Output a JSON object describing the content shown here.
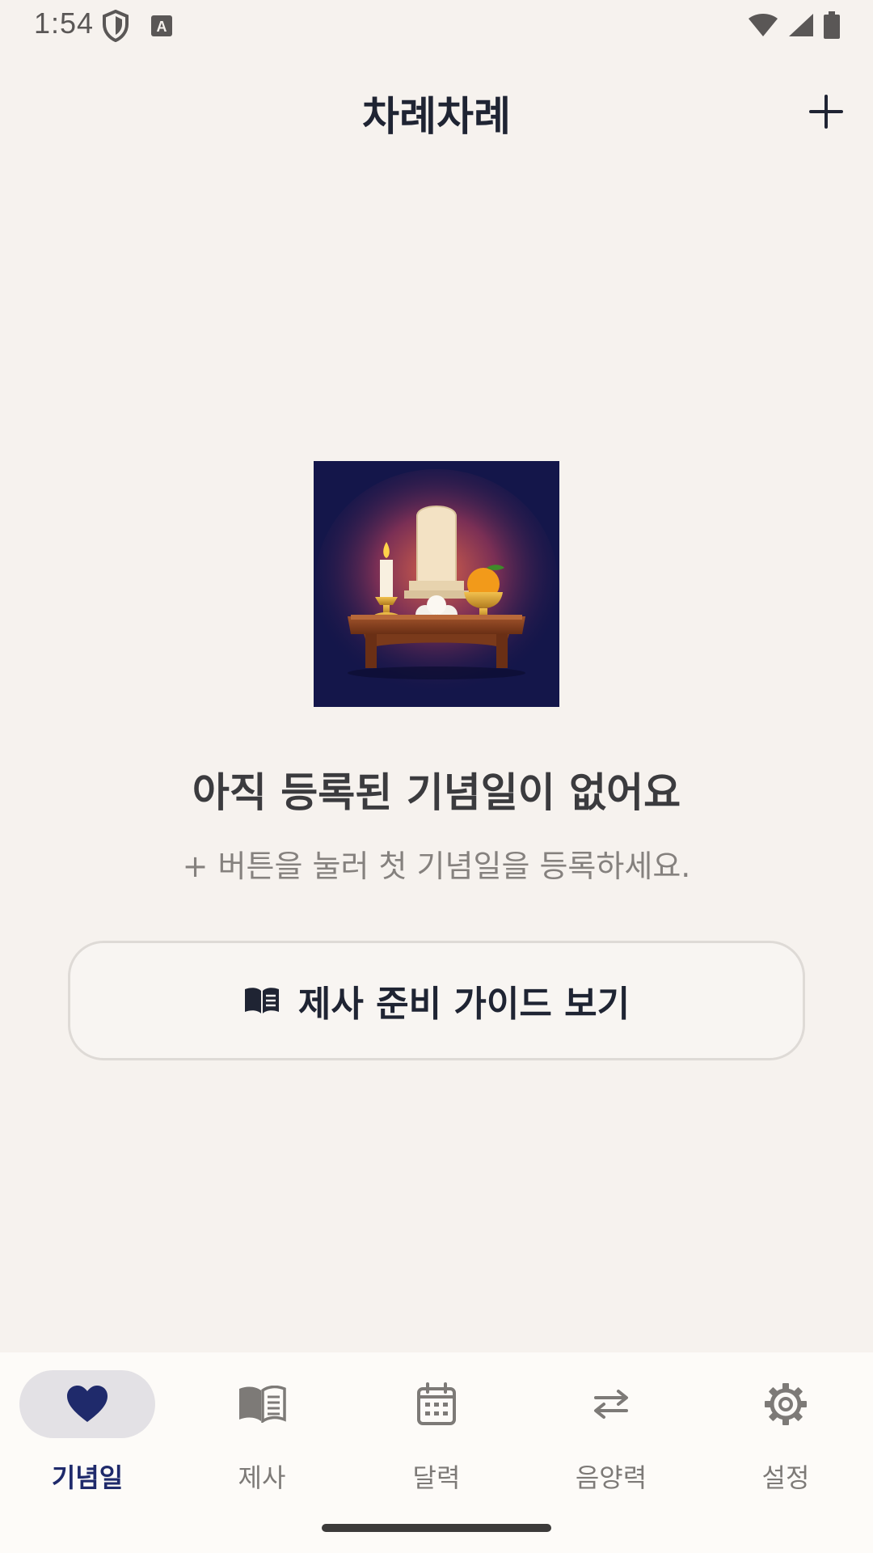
{
  "status_bar": {
    "time": "1:54",
    "icons": [
      "shield-icon",
      "a-box-icon",
      "wifi-icon",
      "signal-icon",
      "battery-icon"
    ]
  },
  "app_bar": {
    "title": "차례차례",
    "add_icon": "plus-icon"
  },
  "empty_state": {
    "illustration": "ancestral-altar-icon",
    "title": "아직 등록된 기념일이 없어요",
    "subtitle": "+ 버튼을 눌러 첫 기념일을 등록하세요.",
    "guide_button_label": "제사 준비 가이드 보기",
    "guide_button_icon": "open-book-icon"
  },
  "bottom_nav": {
    "items": [
      {
        "label": "기념일",
        "icon": "heart-icon",
        "active": true
      },
      {
        "label": "제사",
        "icon": "book-icon",
        "active": false
      },
      {
        "label": "달력",
        "icon": "calendar-icon",
        "active": false
      },
      {
        "label": "음양력",
        "icon": "swap-arrows-icon",
        "active": false
      },
      {
        "label": "설정",
        "icon": "gear-icon",
        "active": false
      }
    ]
  },
  "colors": {
    "background": "#f6f2ee",
    "accent": "#1f2a6b",
    "title_text": "#1f2433",
    "illustration_bg": "#14164a"
  }
}
